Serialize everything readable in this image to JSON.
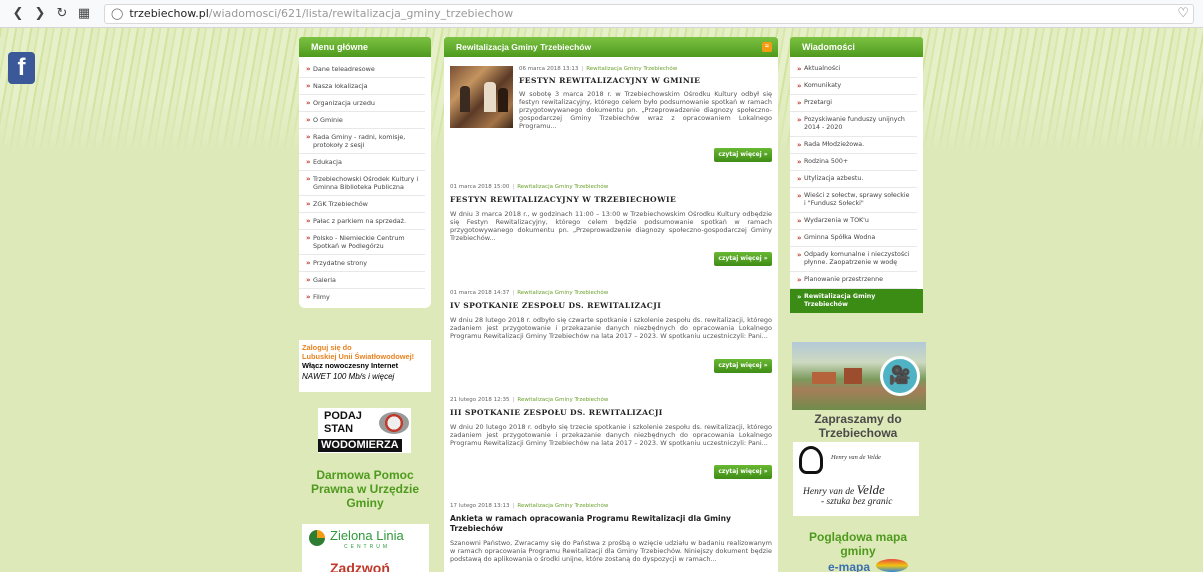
{
  "browser": {
    "url_domain": "trzebiechow.pl",
    "url_path": "/wiadomosci/621/lista/rewitalizacja_gminy_trzebiechow",
    "back_icon": "chevron-left-icon",
    "forward_icon": "chevron-right-icon",
    "reload_icon": "reload-icon",
    "grid_icon": "grid-icon",
    "bookmark_icon": "heart-icon"
  },
  "facebook": {
    "label": "f"
  },
  "left_menu": {
    "title": "Menu główne",
    "items": [
      "Dane teleadresowe",
      "Nasza lokalizacja",
      "Organizacja urzedu",
      "O Gminie",
      "Rada Gminy - radni, komisje, protokoły z sesji",
      "Edukacja",
      "Trzebiechowski Ośrodek Kultury i Gminna Biblioteka Publiczna",
      "ZGK Trzebiechów",
      "Pałac z parkiem na sprzedaż.",
      "Polsko - Niemieckie Centrum Spotkań w Podlegórzu",
      "Przydatne strony",
      "Galeria",
      "Filmy"
    ]
  },
  "banners_left": {
    "swiat_l1": "Zaloguj się do",
    "swiat_l2": "Lubuskiej Unii Światłowodowej!",
    "swiat_l3": "Włącz nowoczesny Internet",
    "swiat_l4": "NAWET 100 Mb/s i więcej",
    "wodo_l1": "PODAJ",
    "wodo_l2": "STAN",
    "wodo_l3": "WODOMIERZA",
    "pomoc": "Darmowa Pomoc Prawna w Urzędzie Gminy",
    "zielona_title": "Zielona Linia",
    "zielona_sub": "CENTRUM",
    "zielona_call": "Zadzwoń"
  },
  "center": {
    "title": "Rewitalizacja Gminy Trzebiechów",
    "rss_icon": "rss-icon",
    "more_label": "czytaj więcej »",
    "articles": [
      {
        "date": "06 marca 2018 13:13",
        "category": "Rewitalizacja Gminy Trzebiechów",
        "title": "FESTYN REWITALIZACYJNY W GMINIE",
        "body": "W sobotę 3 marca 2018 r. w Trzebiechowskim Ośrodku Kultury odbył się festyn rewitalizacyjny, którego celem było podsumowanie spotkań w ramach przygotowywanego dokumentu pn. „Przeprowadzenie diagnozy społeczno-gospodarczej Gminy Trzebiechów wraz z opracowaniem Lokalnego Programu..."
      },
      {
        "date": "01 marca 2018 15:00",
        "category": "Rewitalizacja Gminy Trzebiechów",
        "title": "FESTYN REWITALIZACYJNY W TRZEBIECHOWIE",
        "body": "W dniu 3 marca 2018 r., w godzinach 11:00 – 13:00 w Trzebiechowskim Ośrodku Kultury odbędzie się Festyn Rewitalizacyjny, którego celem będzie podsumowanie spotkań w ramach przygotowywanego dokumentu pn. „Przeprowadzenie diagnozy społeczno-gospodarczej Gminy Trzebiechów..."
      },
      {
        "date": "01 marca 2018 14:37",
        "category": "Rewitalizacja Gminy Trzebiechów",
        "title": "IV SPOTKANIE ZESPOŁU DS. REWITALIZACJI",
        "body": "W dniu 28 lutego 2018 r. odbyło się czwarte spotkanie i szkolenie zespołu ds. rewitalizacji, którego zadaniem jest przygotowanie i przekazanie danych niezbędnych do opracowania Lokalnego Programu Rewitalizacji Gminy Trzebiechów na lata 2017 – 2023. W spotkaniu uczestniczyli: Pani..."
      },
      {
        "date": "21 lutego 2018 12:35",
        "category": "Rewitalizacja Gminy Trzebiechów",
        "title": "III SPOTKANIE ZESPOŁU DS. REWITALIZACJI",
        "body": "W dniu 20 lutego 2018 r. odbyło się trzecie spotkanie i szkolenie zespołu ds. rewitalizacji, którego zadaniem jest przygotowanie i przekazanie danych niezbędnych do opracowania Lokalnego Programu Rewitalizacji Gminy Trzebiechów na lata 2017 – 2023. W spotkaniu uczestniczyli: Pani..."
      },
      {
        "date": "17 lutego 2018 13:13",
        "category": "Rewitalizacja Gminy Trzebiechów",
        "title": "Ankieta w ramach opracowania Programu Rewitalizacji dla Gminy Trzebiechów",
        "body": "Szanowni Państwo, Zwracamy się do Państwa z prośbą o wzięcie udziału w badaniu realizowanym w ramach opracowania Programu Rewitalizacji dla Gminy Trzebiechów. Niniejszy dokument będzie podstawą do aplikowania o środki unijne, które zostaną do dyspozycji w ramach..."
      }
    ]
  },
  "right_menu": {
    "title": "Wiadomości",
    "items": [
      "Aktualności",
      "Komunikaty",
      "Przetargi",
      "Pozyskiwanie funduszy unijnych 2014 - 2020",
      "Rada Młodzieżowa.",
      "Rodzina 500+",
      "Utylizacja azbestu.",
      "Wieści z sołectw, sprawy sołeckie i \"Fundusz Sołecki\"",
      "Wydarzenia w TOK'u",
      "Gminna Spółka Wodna",
      "Odpady komunalne i nieczystości płynne. Zaopatrzenie w wodę",
      "Planowanie przestrzenne"
    ],
    "active_item": "Rewitalizacja Gminy Trzebiechów"
  },
  "banners_right": {
    "zaproszenie": "Zapraszamy do Trzebiechowa",
    "velde_sig": "Henry van de Velde",
    "velde_name_a": "Henry van de ",
    "velde_name_b": "Velde",
    "velde_sub": "- sztuka bez granic",
    "mapa": "Poglądowa mapa gminy",
    "emapa": "e-mapa"
  },
  "colors": {
    "accent_green": "#4e9a1e",
    "link_green": "#6aa02a",
    "bullet_red": "#c0392b",
    "background": "#dde9b8"
  }
}
